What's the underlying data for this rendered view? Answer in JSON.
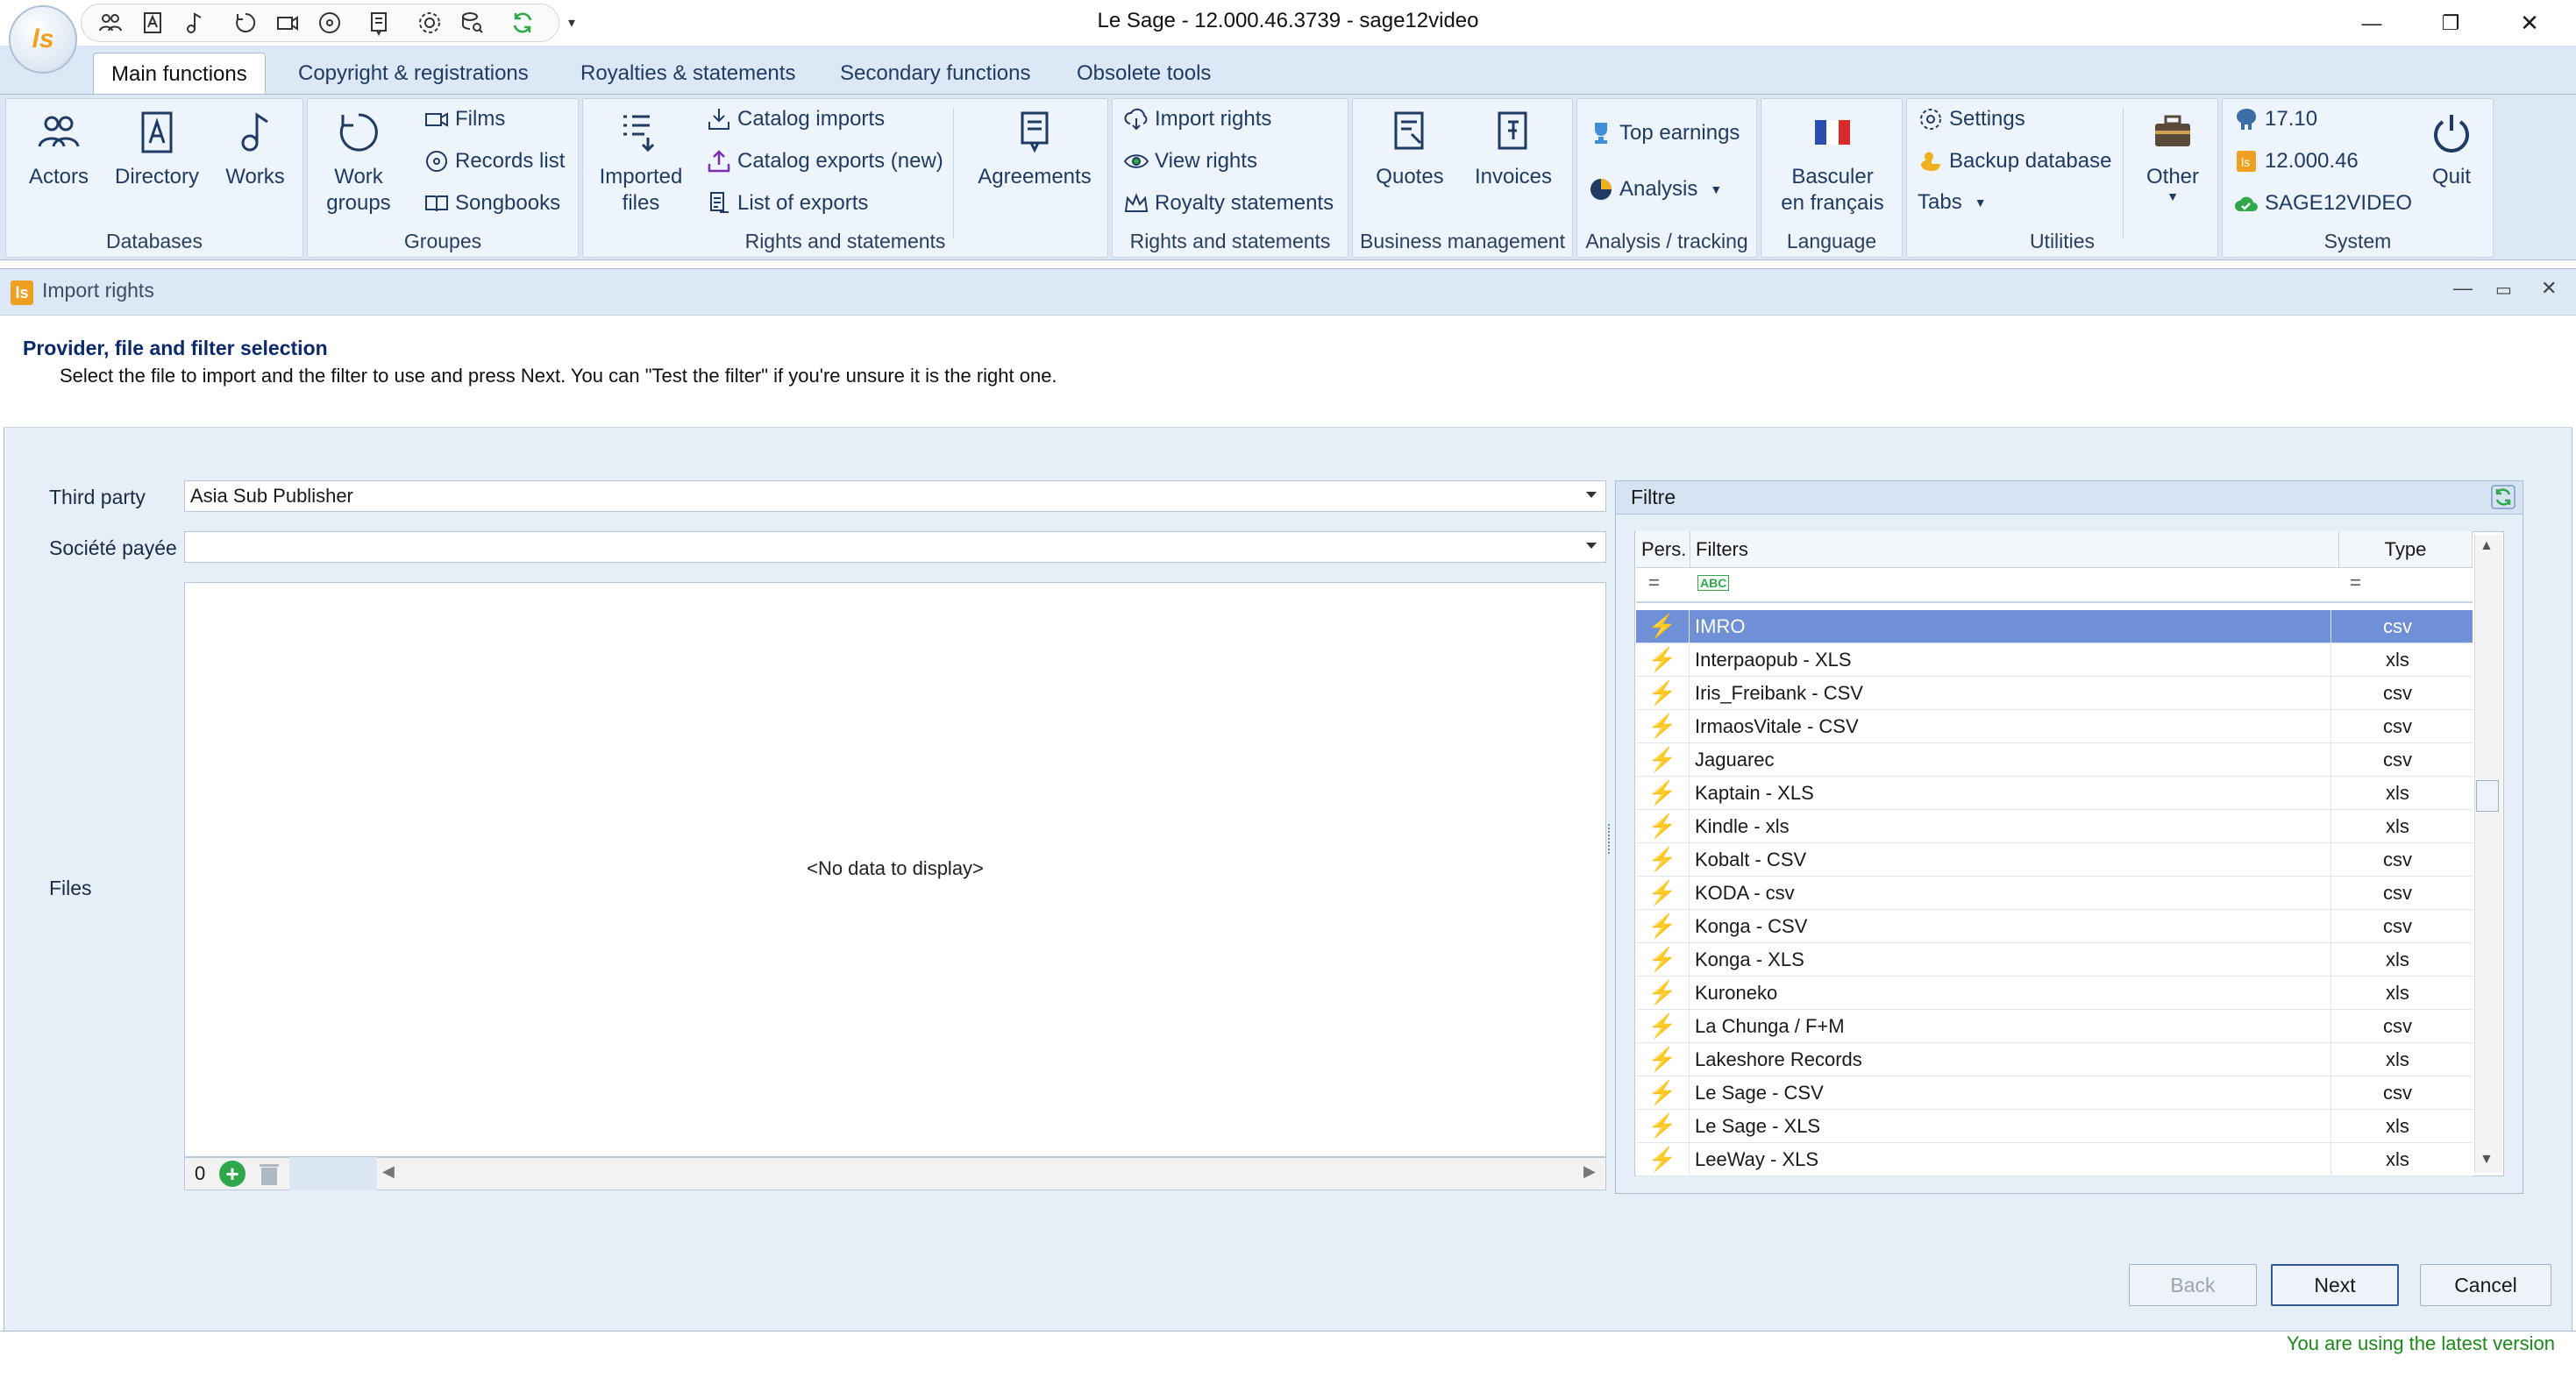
{
  "window": {
    "title": "Le Sage - 12.000.46.3739  -  sage12video",
    "logo_text": "ls",
    "minimize": "—",
    "restore": "❐",
    "close": "✕"
  },
  "tabs": [
    "Main functions",
    "Copyright & registrations",
    "Royalties & statements",
    "Secondary functions",
    "Obsolete tools"
  ],
  "ribbon": {
    "databases": {
      "label": "Databases",
      "actors": "Actors",
      "directory": "Directory",
      "works": "Works"
    },
    "groupes": {
      "label": "Groupes",
      "work_groups_1": "Work",
      "work_groups_2": "groups",
      "films": "Films",
      "records_list": "Records list",
      "songbooks": "Songbooks"
    },
    "rights1": {
      "label": "Rights and statements",
      "imported_files_1": "Imported",
      "imported_files_2": "files",
      "catalog_imports": "Catalog imports",
      "catalog_exports": "Catalog exports (new)",
      "list_of_exports": "List of exports",
      "agreements": "Agreements"
    },
    "rights2": {
      "label": "Rights and statements",
      "import_rights": "Import rights",
      "view_rights": "View rights",
      "royalty_statements": "Royalty statements"
    },
    "business": {
      "label": "Business management",
      "quotes": "Quotes",
      "invoices": "Invoices"
    },
    "analysis": {
      "label": "Analysis / tracking",
      "top_earnings": "Top earnings",
      "analysis": "Analysis"
    },
    "language": {
      "label": "Language",
      "basculer_1": "Basculer",
      "basculer_2": "en français"
    },
    "utilities": {
      "label": "Utilities",
      "settings": "Settings",
      "backup": "Backup database",
      "tabs": "Tabs",
      "other": "Other"
    },
    "system": {
      "label": "System",
      "v1": "17.10",
      "v2": "12.000.46",
      "db": "SAGE12VIDEO",
      "quit": "Quit"
    }
  },
  "document": {
    "title": "Import rights",
    "heading": "Provider, file and filter selection",
    "description": "Select the file to import and the filter to use and press Next. You can \"Test the filter\" if you're unsure it is the right one."
  },
  "form": {
    "third_party_label": "Third party",
    "third_party_value": "Asia Sub Publisher",
    "societe_label": "Société payée",
    "societe_value": "",
    "files_label": "Files",
    "files_empty": "<No data to display>",
    "files_count": "0"
  },
  "filter": {
    "title": "Filtre",
    "col_pers": "Pers.",
    "col_filters": "Filters",
    "col_type": "Type",
    "filter_row_sym": "=",
    "rows": [
      {
        "name": "IMRO",
        "type": "csv"
      },
      {
        "name": "Interpaopub - XLS",
        "type": "xls"
      },
      {
        "name": "Iris_Freibank - CSV",
        "type": "csv"
      },
      {
        "name": "IrmaosVitale - CSV",
        "type": "csv"
      },
      {
        "name": "Jaguarec",
        "type": "csv"
      },
      {
        "name": "Kaptain - XLS",
        "type": "xls"
      },
      {
        "name": "Kindle - xls",
        "type": "xls"
      },
      {
        "name": "Kobalt - CSV",
        "type": "csv"
      },
      {
        "name": "KODA - csv",
        "type": "csv"
      },
      {
        "name": "Konga - CSV",
        "type": "csv"
      },
      {
        "name": "Konga - XLS",
        "type": "xls"
      },
      {
        "name": "Kuroneko",
        "type": "xls"
      },
      {
        "name": "La Chunga / F+M",
        "type": "csv"
      },
      {
        "name": "Lakeshore Records",
        "type": "xls"
      },
      {
        "name": "Le Sage - CSV",
        "type": "csv"
      },
      {
        "name": "Le Sage - XLS",
        "type": "xls"
      },
      {
        "name": "LeeWay - XLS",
        "type": "xls"
      }
    ]
  },
  "buttons": {
    "back": "Back",
    "next": "Next",
    "cancel": "Cancel"
  },
  "status": "You are using the latest version"
}
